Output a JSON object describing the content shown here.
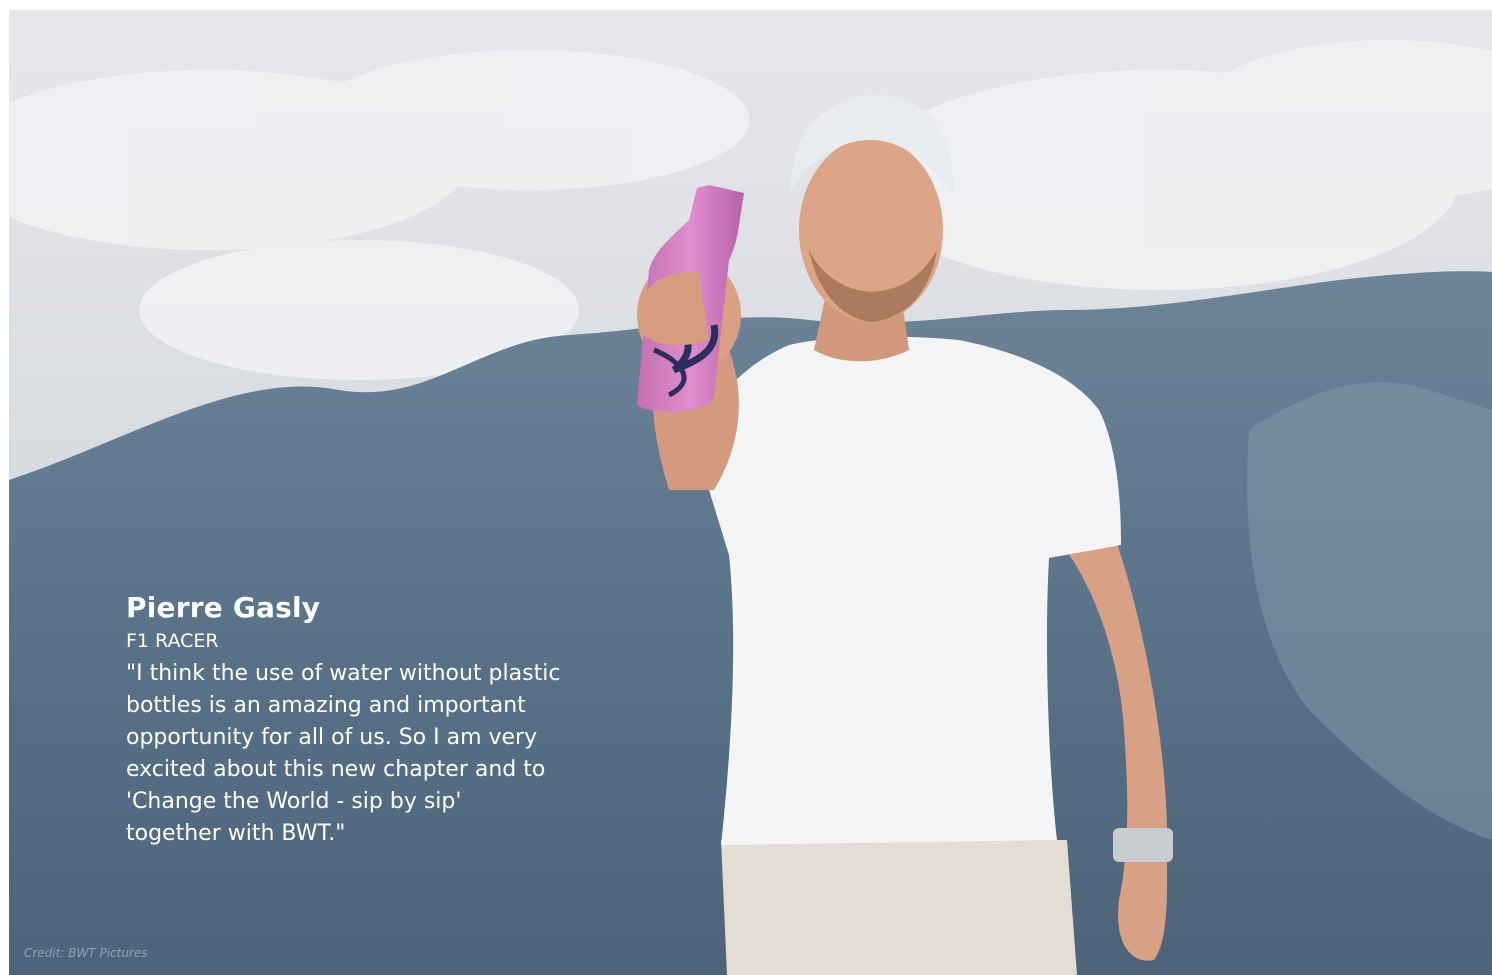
{
  "hero": {
    "image_subject": "person-holding-pink-bottle",
    "colors": {
      "sky": "#dfe1e4",
      "mountain": "#5a738a",
      "shirt": "#f4f5f7",
      "bottle": "#d77fc4",
      "pants": "#e3ddd3"
    }
  },
  "caption": {
    "name": "Pierre Gasly",
    "role": "F1 RACER",
    "quote": "\"I think the use of water without plastic\nbottles is an amazing and important\nopportunity for all of us. So I am very\nexcited about this new chapter and to\n'Change the World - sip by sip'\ntogether with BWT.\""
  },
  "credit": {
    "text": "Credit:  BWT Pictures"
  }
}
